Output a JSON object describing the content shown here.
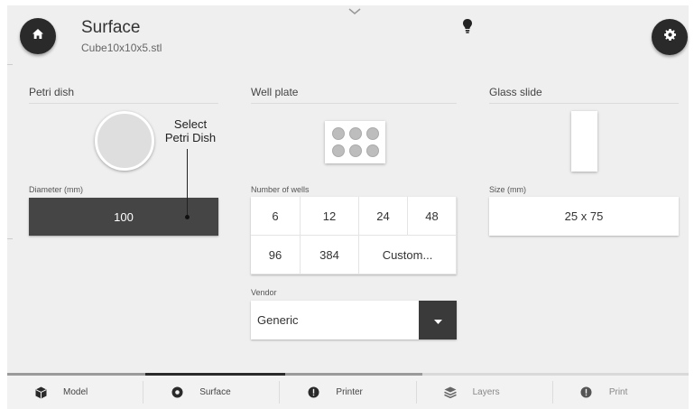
{
  "header": {
    "title": "Surface",
    "subtitle": "Cube10x10x5.stl"
  },
  "icons": {
    "home": "home-icon",
    "settings": "gear-icon",
    "tip": "lightbulb-icon",
    "expand": "chevron-down-icon"
  },
  "petri": {
    "title": "Petri dish",
    "label": "Diameter (mm)",
    "value": "100"
  },
  "well_plate": {
    "title": "Well plate",
    "label": "Number of wells",
    "options": [
      "6",
      "12",
      "24",
      "48",
      "96",
      "384",
      "Custom..."
    ]
  },
  "glass": {
    "title": "Glass slide",
    "label": "Size (mm)",
    "value": "25 x 75"
  },
  "vendor": {
    "label": "Vendor",
    "value": "Generic"
  },
  "annotation": {
    "line1": "Select",
    "line2": "Petri Dish"
  },
  "progress": {
    "completed_steps": 3,
    "total_steps": 5,
    "active_step": "Surface"
  },
  "nav": {
    "items": [
      {
        "label": "Model",
        "icon": "cube-icon"
      },
      {
        "label": "Surface",
        "icon": "target-icon"
      },
      {
        "label": "Printer",
        "icon": "alert-icon"
      },
      {
        "label": "Layers",
        "icon": "layers-icon"
      },
      {
        "label": "Print",
        "icon": "alert-icon"
      }
    ]
  },
  "colors": {
    "dark": "#2a2a2a",
    "field_active": "#454545",
    "background": "#efefef"
  }
}
